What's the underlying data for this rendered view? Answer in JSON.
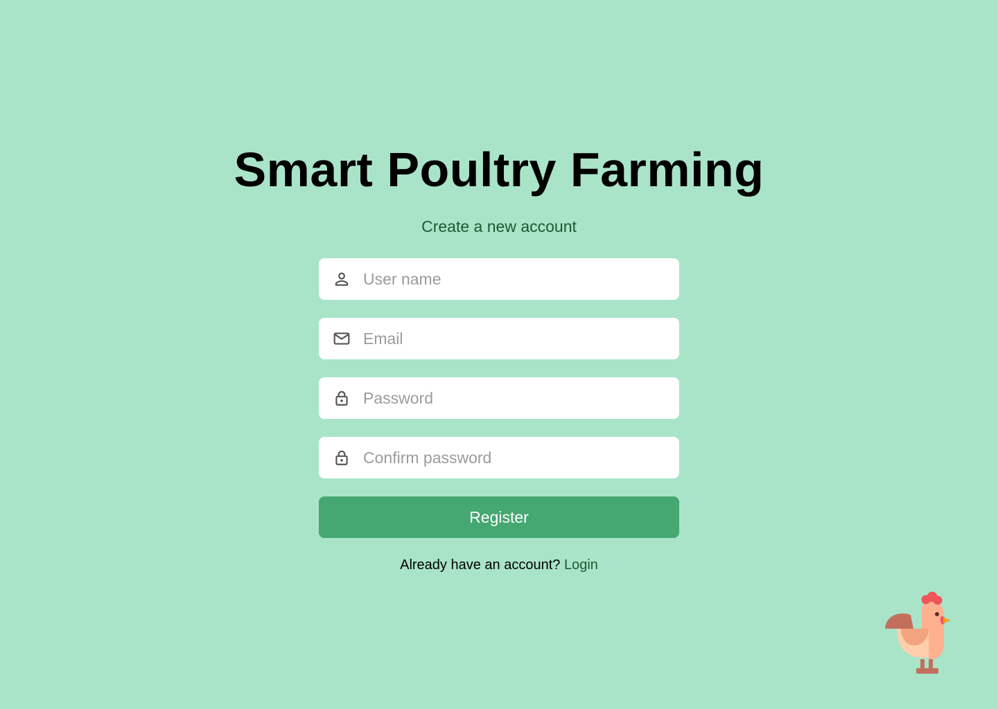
{
  "app": {
    "title": "Smart Poultry Farming",
    "subtitle": "Create a new account"
  },
  "form": {
    "username": {
      "placeholder": "User name",
      "value": "",
      "icon": "user-icon"
    },
    "email": {
      "placeholder": "Email",
      "value": "",
      "icon": "mail-icon"
    },
    "password": {
      "placeholder": "Password",
      "value": "",
      "icon": "lock-icon"
    },
    "confirm_password": {
      "placeholder": "Confirm password",
      "value": "",
      "icon": "lock-icon"
    },
    "register_label": "Register"
  },
  "footer": {
    "prompt": "Already have an account?",
    "login_label": "Login"
  },
  "colors": {
    "background": "#a9e4c9",
    "accent": "#45a771",
    "link": "#1b5a30",
    "field_background": "#ffffff",
    "placeholder": "#9b9b9b"
  },
  "illustration": "rooster-illustration"
}
